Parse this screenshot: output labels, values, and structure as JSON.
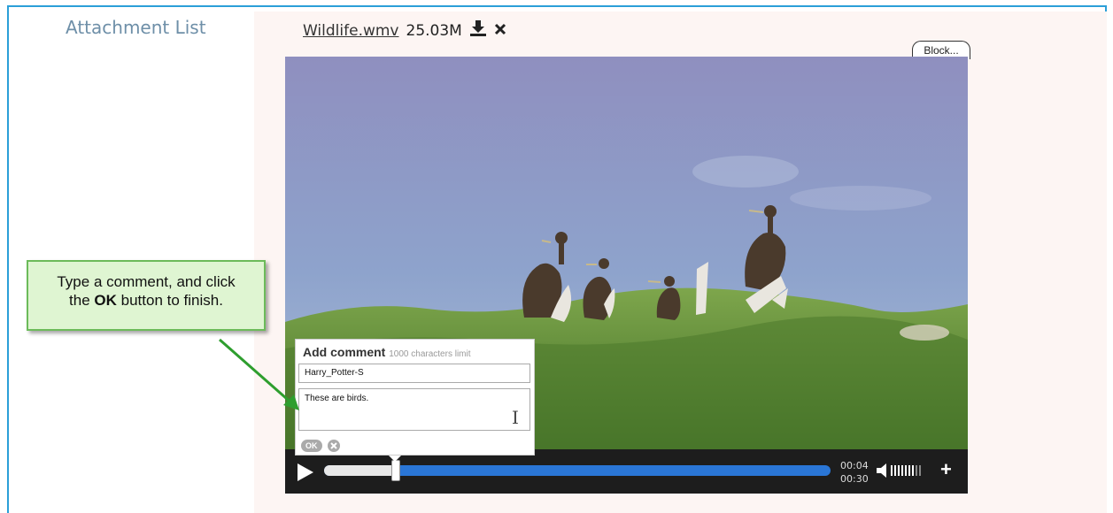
{
  "attachments": {
    "label": "Attachment List",
    "file": {
      "name": "Wildlife.wmv",
      "size": "25.03M",
      "download_icon": "download-icon",
      "remove_icon": "close-icon"
    },
    "block_button": "Block..."
  },
  "player": {
    "current_time": "00:04",
    "total_time": "00:30",
    "progress": 0.14,
    "icons": {
      "play": "play-icon",
      "volume": "volume-icon",
      "fullscreen": "plus-icon"
    }
  },
  "comment": {
    "title": "Add comment",
    "limit": "1000 characters limit",
    "name_value": "Harry_Potter-S",
    "text_value": "These are birds.",
    "ok_label": "OK",
    "cancel_icon": "cancel-icon"
  },
  "callout": {
    "line1": "Type a comment, and click",
    "line2_pre": "the ",
    "line2_bold": "OK",
    "line2_post": " button to finish."
  },
  "colors": {
    "frame": "#2b9fd8",
    "progress": "#2a76d6",
    "callout_bg": "#dff5d2",
    "callout_border": "#6cbb5a"
  }
}
